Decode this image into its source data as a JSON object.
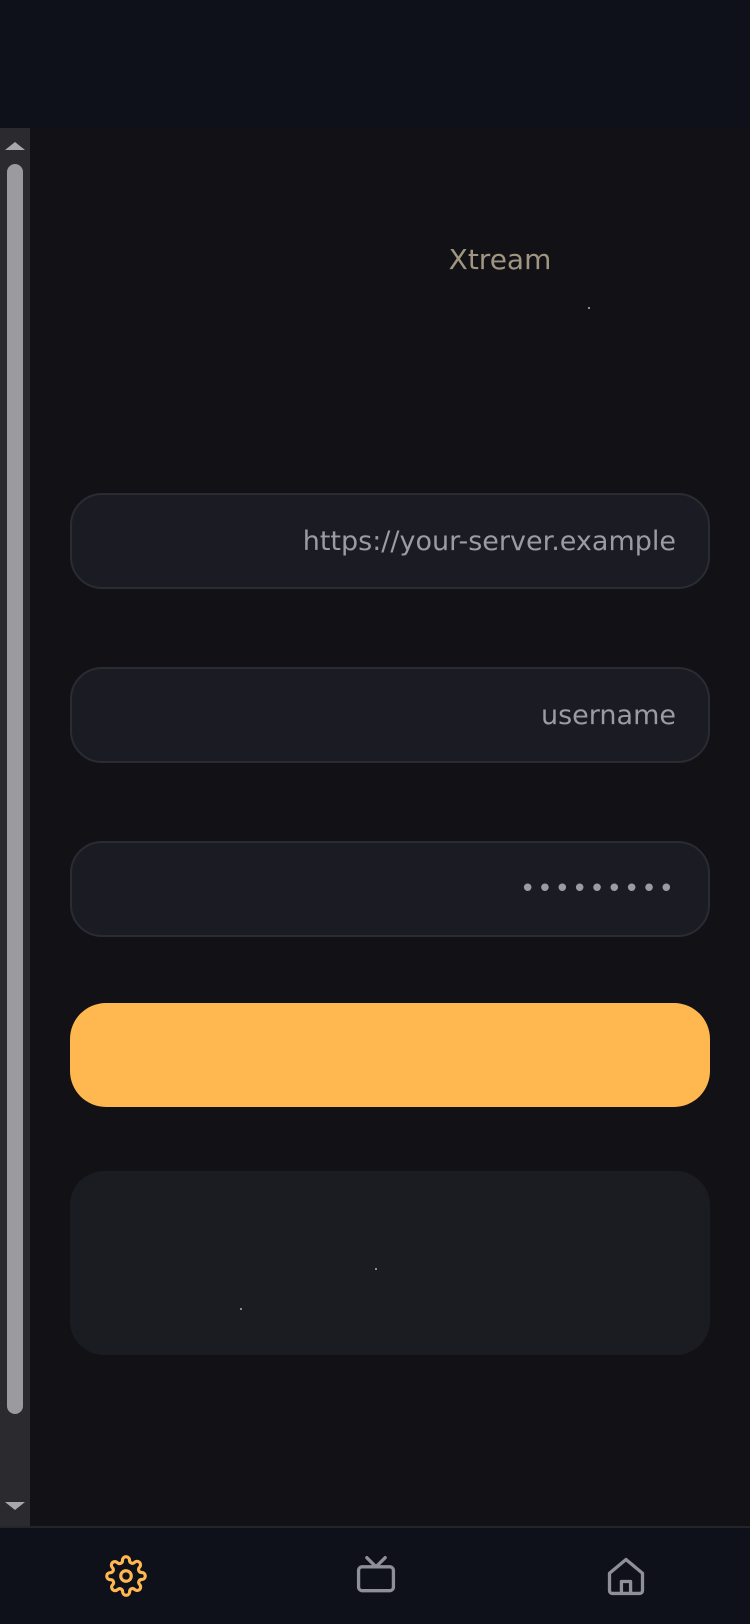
{
  "app": {
    "brand": "Xtream",
    "accent_color": "#ffb84f",
    "background_color": "#111116"
  },
  "login_form": {
    "server_placeholder": "https://your-server.example",
    "username_placeholder": "username",
    "password_placeholder": "•••••••••",
    "submit_label": ""
  },
  "bottom_nav": {
    "items": [
      {
        "icon": "gear-icon",
        "active": true
      },
      {
        "icon": "tv-icon",
        "active": false
      },
      {
        "icon": "home-icon",
        "active": false
      }
    ]
  }
}
